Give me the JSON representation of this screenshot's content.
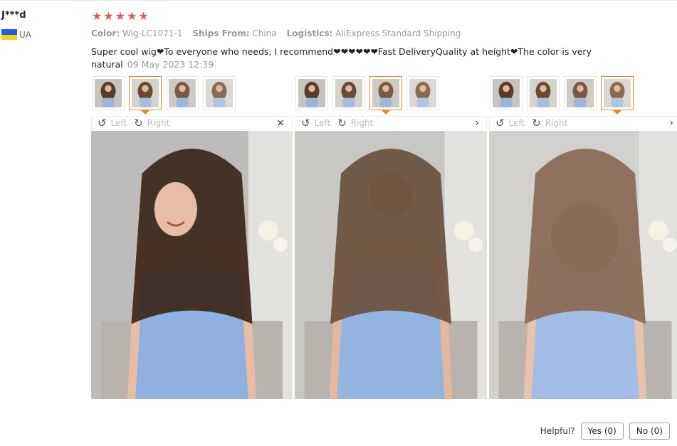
{
  "user": {
    "name": "J***d",
    "country_code": "UA"
  },
  "rating": {
    "stars": 5,
    "max": 5,
    "color": "#f0504d"
  },
  "attributes": [
    {
      "label": "Color:",
      "value": "Wig-LC1071-1"
    },
    {
      "label": "Ships From:",
      "value": "China"
    },
    {
      "label": "Logistics:",
      "value": "AliExpress Standard Shipping"
    }
  ],
  "review": {
    "text": "Super cool wig❤To everyone who needs, I recommend❤❤❤❤❤❤Fast DeliveryQuality at height❤The color is very natural",
    "date": "09 May 2023 12:39"
  },
  "galleries": [
    {
      "active_thumb": 1,
      "toolbar": {
        "left": "Left",
        "right": "Right",
        "close": "×"
      }
    },
    {
      "active_thumb": 2,
      "toolbar": {
        "left": "Left",
        "right": "Right",
        "close": "›"
      }
    },
    {
      "active_thumb": 3,
      "toolbar": {
        "left": "Left",
        "right": "Right",
        "close": "›"
      }
    }
  ],
  "helpful": {
    "label": "Helpful?",
    "yes": "Yes (0)",
    "no": "No (0)"
  },
  "colors": {
    "accent": "#e6862a",
    "flag_blue": "#2a5bd7",
    "flag_yellow": "#f7d21b"
  }
}
